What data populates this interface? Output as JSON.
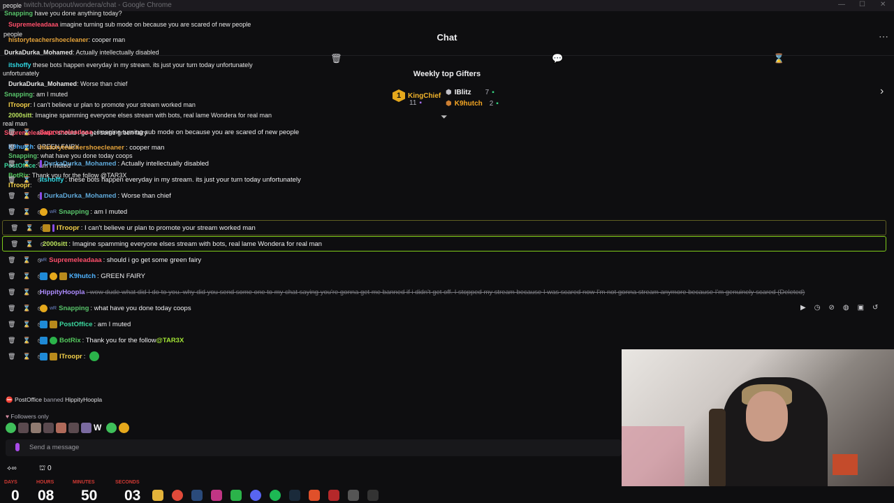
{
  "browser": {
    "url": "twitch.tv/popout/wondera/chat - Google Chrome"
  },
  "header": {
    "title": "Chat"
  },
  "gifters": {
    "title": "Weekly top Gifters",
    "first": {
      "name": "KingChief",
      "count": "11",
      "rank": "1"
    },
    "second": {
      "name": "IBlitz",
      "count": "7"
    },
    "third": {
      "name": "K9hutch",
      "count": "2"
    }
  },
  "messages": [
    {
      "user": "Supremeleadaaa",
      "color": "#ff4f6a",
      "text": ": imagine turning sub mode on because you are scared of new people",
      "hl": "",
      "badges": []
    },
    {
      "user": "historyteachershoecleaner",
      "color": "#e3a23a",
      "text": ": cooper man",
      "hl": "",
      "badges": []
    },
    {
      "user": "DurkaDurka_Mohamed",
      "color": "#5fa8d8",
      "text": ": Actually intellectually disabled",
      "hl": "",
      "badges": [
        "purple"
      ]
    },
    {
      "user": "itshoffy",
      "color": "#2fd6e0",
      "text": ": these bots happen everyday in my stream. its just your turn today unfortunately",
      "hl": "",
      "badges": []
    },
    {
      "user": "DurkaDurka_Mohamed",
      "color": "#5fa8d8",
      "text": ": Worse than chief",
      "hl": "",
      "badges": [
        "purple"
      ]
    },
    {
      "user": "Snapping",
      "color": "#58c36a",
      "text": ": am I muted",
      "hl": "",
      "badges": [
        "gold",
        "wr"
      ]
    },
    {
      "user": "ITroopr",
      "color": "#f5d24a",
      "text": ": I can't believe ur plan to promote your stream worked man",
      "hl": "hl",
      "badges": [
        "crown",
        "purple"
      ]
    },
    {
      "user": "2000sitt",
      "color": "#b9e15d",
      "text": ": Imagine spamming everyone elses stream with bots, real lame Wondera for real man",
      "hl": "hl2",
      "badges": []
    },
    {
      "user": "Supremeleadaaa",
      "color": "#ff4f6a",
      "text": ": should i go get some green fairy",
      "hl": "",
      "badges": [
        "wr"
      ]
    },
    {
      "user": "K9hutch",
      "color": "#4fb3ff",
      "text": ": GREEN FAIRY",
      "hl": "",
      "badges": [
        "blue",
        "gold",
        "crown"
      ]
    },
    {
      "user": "HippityHoopla",
      "color": "#ad8cff",
      "text": ": wow dude what did I do to you. why did you send some one to my chat saying you're gonna get me banned if i didn't get off. I stopped my stream because I was scared now I'm not gonna stream anymore because I'm genuinely scared (Deleted)",
      "hl": "",
      "badges": [],
      "deleted": true
    },
    {
      "user": "Snapping",
      "color": "#58c36a",
      "text": ": what have you done today coops",
      "hl": "",
      "badges": [
        "gold",
        "wr"
      ]
    },
    {
      "user": "PostOffice",
      "color": "#3cd9a0",
      "text": ": am I muted",
      "hl": "",
      "badges": [
        "blue",
        "crown"
      ]
    },
    {
      "user": "BotRix",
      "color": "#54c95e",
      "text": ": Thank you for the follow ",
      "mention": "@TAR3X",
      "hl": "",
      "badges": [
        "blue",
        "green"
      ]
    },
    {
      "user": "ITroopr",
      "color": "#f5d24a",
      "text": ":",
      "hl": "",
      "badges": [
        "blue",
        "crown"
      ],
      "emote": true
    }
  ],
  "overlay": [
    {
      "user": "Snapping",
      "text": " have you done anything today?"
    },
    {
      "user": "Supremeleadaaa",
      "text": " imagine turning sub mode on because you are scared of new people"
    },
    {
      "user": "historyteachershoecleaner",
      "text": ": cooper man"
    },
    {
      "user": "DurkaDurka_Mohamed",
      "text": ": Actually intellectually disabled"
    },
    {
      "user": "itshoffy",
      "text": " these bots happen everyday in my stream. its just your turn today unfortunately"
    },
    {
      "user": "DurkaDurka_Mohamed",
      "text": ": Worse than chief"
    },
    {
      "user": "Snapping",
      "text": ": am I muted"
    },
    {
      "user": "ITroopr",
      "text": ": I can't believe ur plan to promote your stream worked man"
    },
    {
      "user": "2000sitt",
      "text": ": Imagine spamming everyone elses stream with bots, real lame Wondera for real man"
    },
    {
      "user": "Supremeleadaaa",
      "text": ": should i go get some green fairy"
    },
    {
      "user": "K9hutch",
      "text": ": GREEN FAIRY"
    },
    {
      "user": "Snapping",
      "text": ": what have you done today coops"
    },
    {
      "user": "PostOffice",
      "text": ": am I muted"
    },
    {
      "user": "BotRix",
      "text": ": Thank you for the follow @TAR3X"
    },
    {
      "user": "ITroopr",
      "text": ":"
    }
  ],
  "overlay_extra": {
    "top": "people",
    "mid": "people",
    "end": "real man",
    "unf": "unfortunately"
  },
  "footer": {
    "banned_user": "PostOffice",
    "banned_text": "banned",
    "banned_target": "HippityHoopla",
    "followers_only": "Followers only",
    "placeholder": "Send a message",
    "points": "0"
  },
  "timer": {
    "labels": [
      "DAYS",
      "HOURS",
      "MINUTES",
      "SECONDS"
    ],
    "days": "0",
    "hours": "08",
    "minutes": "50",
    "seconds": "03"
  },
  "colors": {
    "accent": "#a970ff",
    "timer_label": "#d23a34"
  },
  "icons": [
    "trash-icon",
    "chat-bubble-icon",
    "hourglass-icon",
    "more-icon",
    "chevron-right-icon",
    "play-icon",
    "clock-icon",
    "mute-icon",
    "chat-settings-icon",
    "copy-icon",
    "undo-icon"
  ]
}
